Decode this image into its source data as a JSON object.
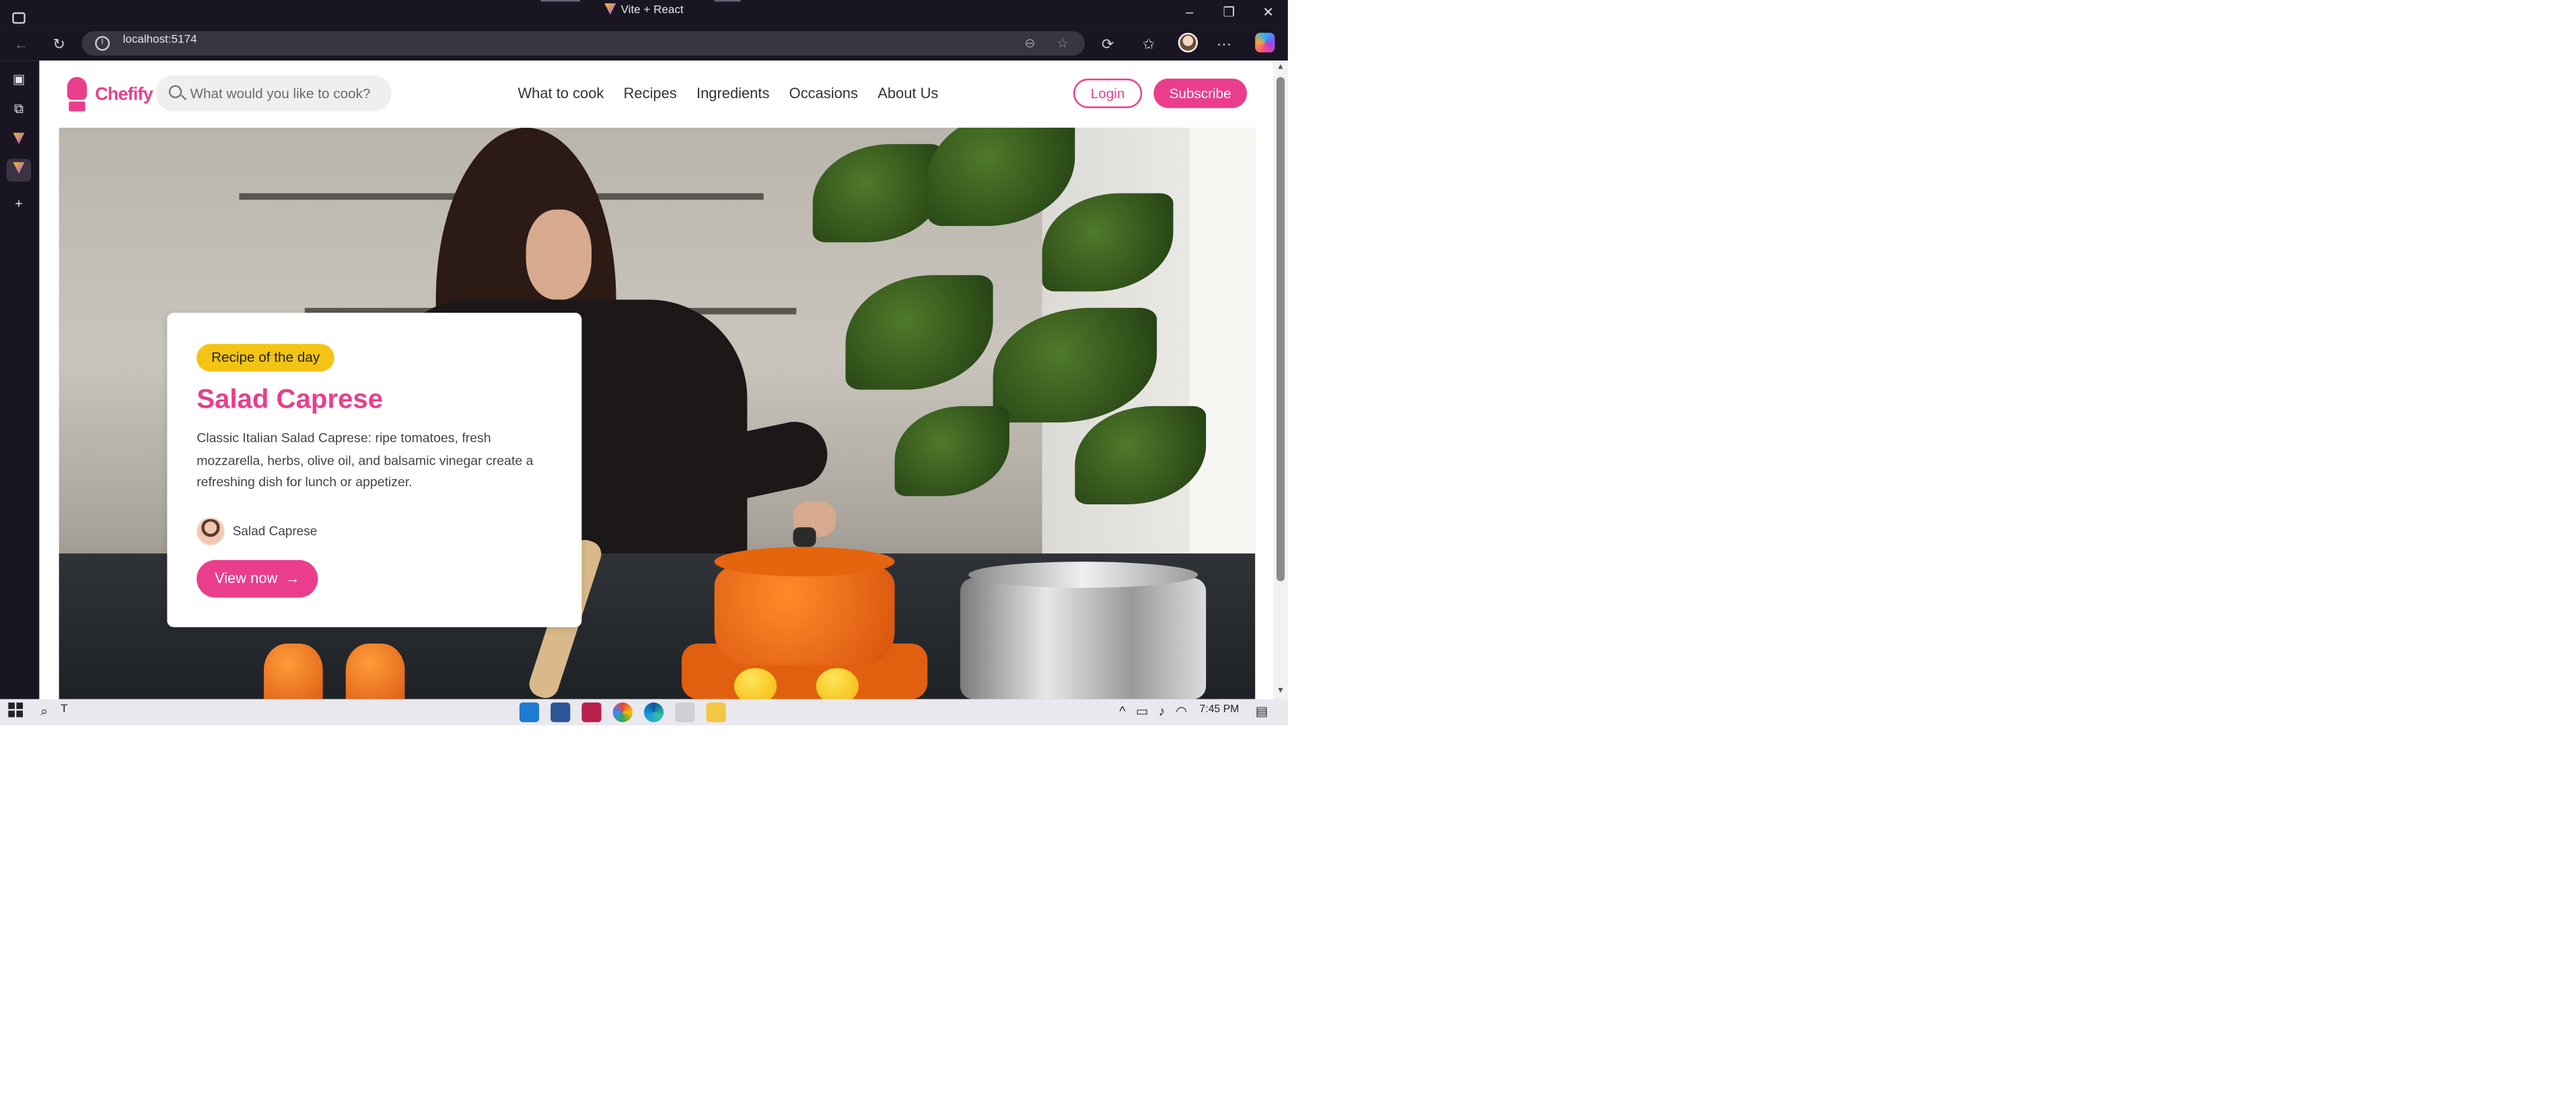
{
  "browser": {
    "window_title": "Vite + React",
    "url": "localhost:5174",
    "back_icon": "arrow-left-icon",
    "refresh_icon": "refresh-icon"
  },
  "site": {
    "brand": "Chefify",
    "search_placeholder": "What would you like to cook?",
    "nav": [
      "What to cook",
      "Recipes",
      "Ingredients",
      "Occasions",
      "About Us"
    ],
    "login_label": "Login",
    "subscribe_label": "Subscribe",
    "accent_color": "#ea3e8c"
  },
  "hero_card": {
    "badge": "Recipe of the day",
    "title": "Salad Caprese",
    "description": "Classic Italian Salad Caprese: ripe tomatoes, fresh mozzarella, herbs, olive oil, and balsamic vinegar create a refreshing dish for lunch or appetizer.",
    "author": "Salad Caprese",
    "cta_label": "View now",
    "cta_arrow": "→"
  },
  "taskbar": {
    "search_text": "T",
    "time": "7:45 PM"
  }
}
